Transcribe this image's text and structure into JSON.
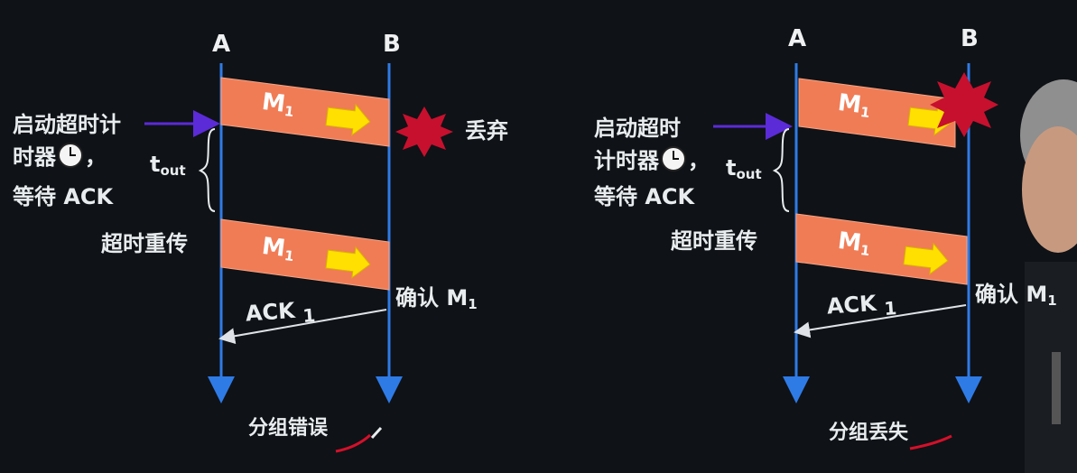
{
  "left": {
    "node_a": "A",
    "node_b": "B",
    "packet1": "M",
    "packet1_sub": "1",
    "packet2": "M",
    "packet2_sub": "1",
    "start_label": "启动超时计\n时器",
    "start_label_tail": "，",
    "wait_label": "等待 ACK",
    "tout": "t",
    "tout_sub": "out",
    "discard": "丢弃",
    "retransmit": "超时重传",
    "ack": "ACK",
    "ack_sub": "1",
    "confirm": "确认 M",
    "confirm_sub": "1",
    "caption": "分组错误"
  },
  "right": {
    "node_a": "A",
    "node_b": "B",
    "packet1": "M",
    "packet1_sub": "1",
    "packet2": "M",
    "packet2_sub": "1",
    "start_label_line1": "启动超时",
    "start_label_line2": "计时器",
    "start_label_tail": "，",
    "wait_label": "等待 ACK",
    "tout": "t",
    "tout_sub": "out",
    "retransmit": "超时重传",
    "ack": "ACK",
    "ack_sub": "1",
    "confirm": "确认 M",
    "confirm_sub": "1",
    "caption": "分组丢失"
  },
  "colors": {
    "background": "#0f1216",
    "timeline": "#2f7be6",
    "packet_fill": "#f07c56",
    "packet_border": "#f4a486",
    "arrow_fill": "#ffe000",
    "burst": "#c7102e",
    "pointer": "#5b2bd8",
    "underline": "#d4102a"
  },
  "icons": [
    "clock-icon",
    "explosion-icon",
    "right-arrow-icon"
  ]
}
